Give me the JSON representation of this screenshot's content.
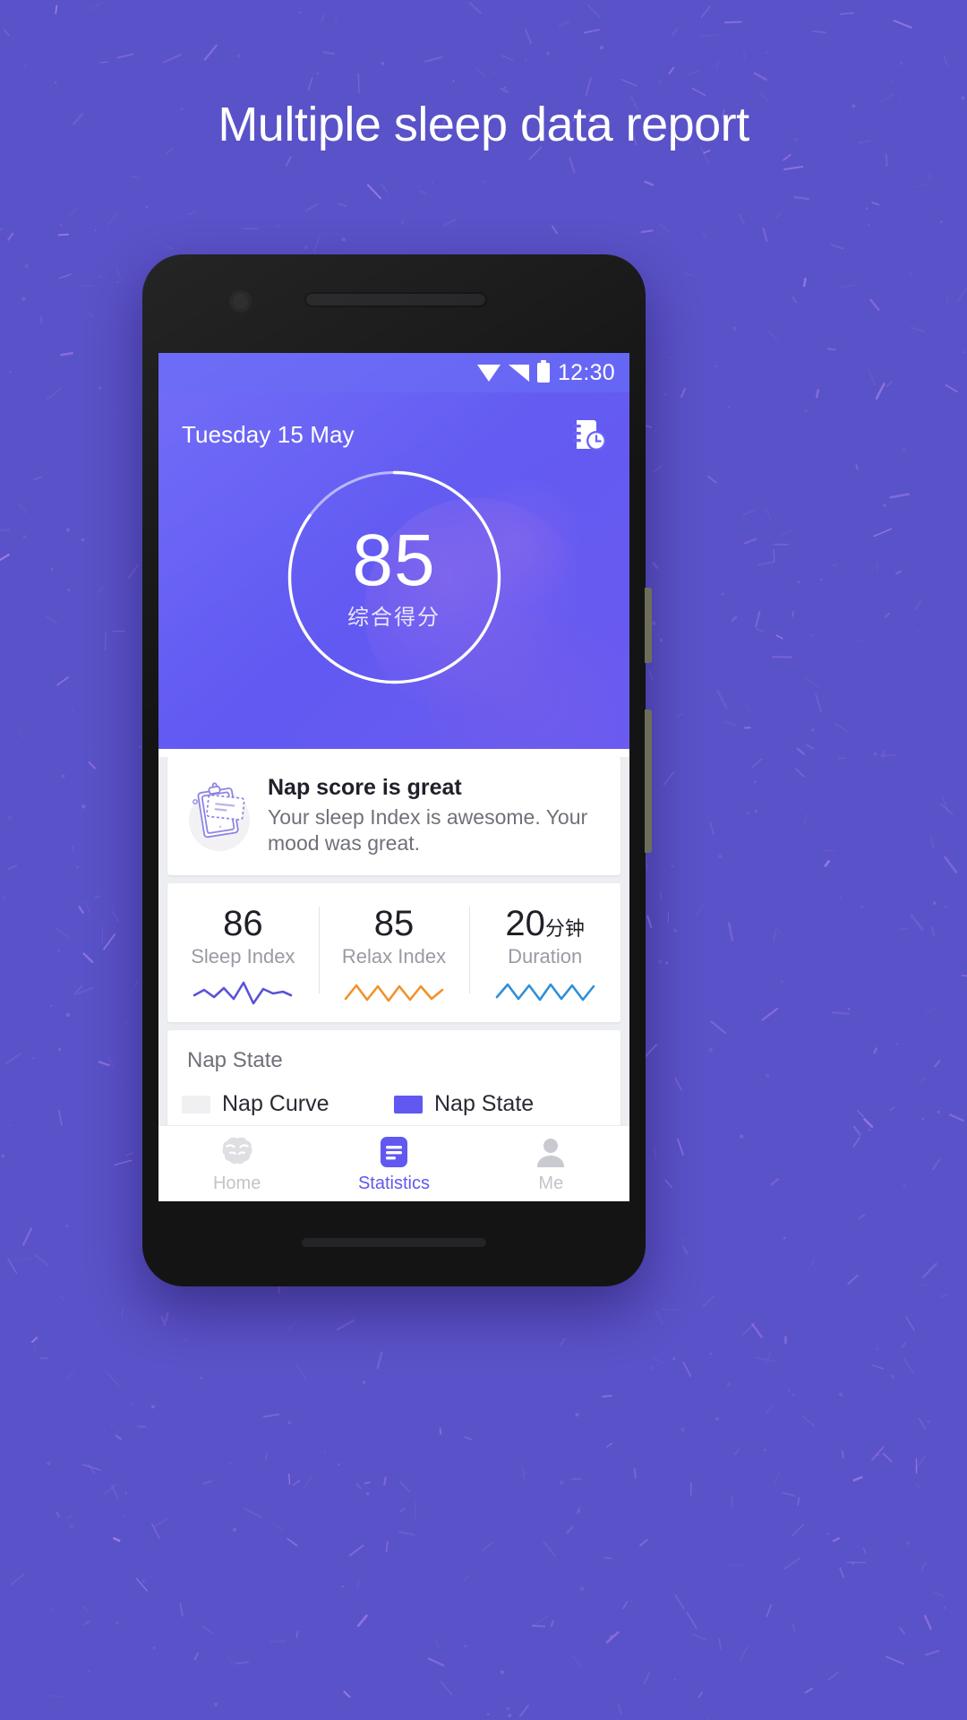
{
  "promo": {
    "headline": "Multiple sleep data report"
  },
  "theme": {
    "brand_purple": "#6058f0",
    "page_background": "#5a52c8",
    "hero_gradient_start": "#6a64f7",
    "hero_gradient_end": "#6b5bf0",
    "card_background": "#ffffff",
    "cards_area_background": "#eceef1",
    "sleep_index_line": "#5a52d8",
    "relax_index_line": "#f0922b",
    "duration_line": "#2f8fd8"
  },
  "status_bar": {
    "time": "12:30",
    "icons": [
      "wifi-icon",
      "signal-icon",
      "battery-icon"
    ]
  },
  "header": {
    "date": "Tuesday 15 May",
    "report_icon": "report-history-icon"
  },
  "score_ring": {
    "value": "85",
    "label": "综合得分",
    "progress_percent": 85,
    "track_color": "#ffffff",
    "progress_color": "#ffffff"
  },
  "nap_card": {
    "icon": "clipboard-icon",
    "title": "Nap score is great",
    "body": "Your sleep Index is awesome. Your mood was great."
  },
  "stats": [
    {
      "value": "86",
      "unit": "",
      "label": "Sleep Index",
      "sparkline": "sleep-index-sparkline",
      "color": "#5a52d8"
    },
    {
      "value": "85",
      "unit": "",
      "label": "Relax Index",
      "sparkline": "relax-index-sparkline",
      "color": "#f0922b"
    },
    {
      "value": "20",
      "unit": "分钟",
      "label": "Duration",
      "sparkline": "duration-sparkline",
      "color": "#2f8fd8"
    }
  ],
  "nap_state": {
    "title": "Nap State",
    "legend": [
      {
        "label": "Nap Curve",
        "color": "#f0f0f3"
      },
      {
        "label": "Nap State",
        "color": "#6058f0"
      }
    ]
  },
  "bottom_nav": {
    "items": [
      {
        "label": "Home",
        "icon": "brain-icon",
        "active": false
      },
      {
        "label": "Statistics",
        "icon": "document-icon",
        "active": true
      },
      {
        "label": "Me",
        "icon": "person-icon",
        "active": false
      }
    ]
  }
}
